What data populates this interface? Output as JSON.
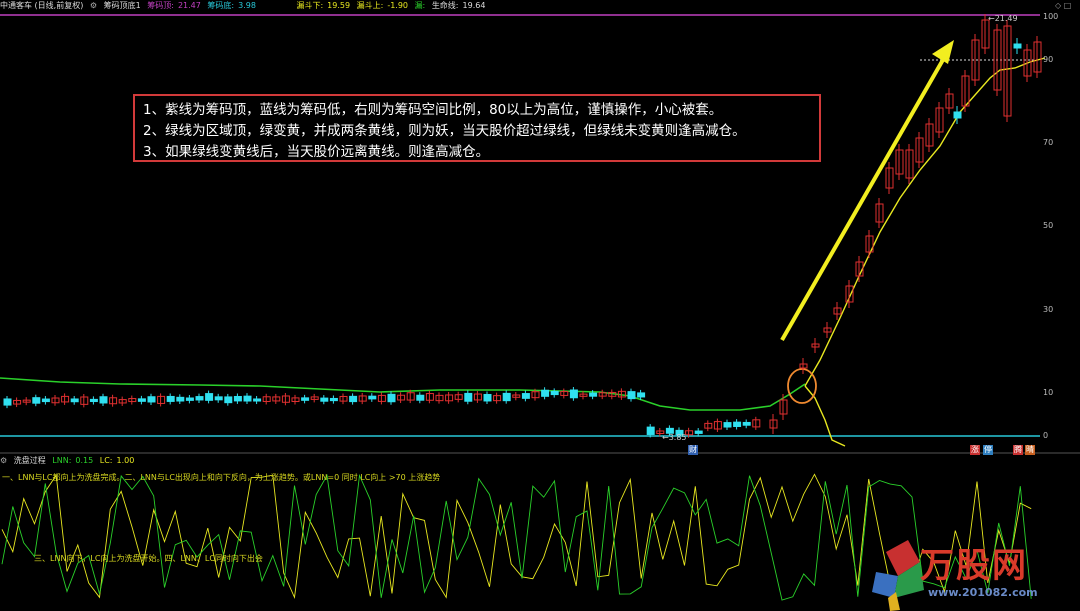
{
  "header": {
    "stock_title": "中通客车 (日线,前复权)",
    "indicator_name": "筹码顶底1",
    "chip_top_label": "筹码顶:",
    "chip_top_value": "21.47",
    "chip_bottom_label": "筹码底:",
    "chip_bottom_value": "3.98",
    "funnel_down_label": "漏斗下:",
    "funnel_down_value": "19.59",
    "funnel_up_label": "漏斗上:",
    "funnel_up_value": "-1.90",
    "stop_label": "漏:",
    "stop_value": "",
    "life_label": "生命线:",
    "life_value": "19.64"
  },
  "annotation": {
    "line1": "1、紫线为筹码顶，蓝线为筹码低，右则为筹码空间比例，80以上为高位，谨慎操作，小心被套。",
    "line2": "2、绿线为区域顶，绿变黄，并成两条黄线，则为妖，当天股价超过绿线，但绿线未变黄则逢高减仓。",
    "line3": "3、如果绿线变黄线后，当天股价远离黄线。则逢高减仓。"
  },
  "axis": {
    "labels": [
      "100",
      "90",
      "70",
      "50",
      "30",
      "10",
      "0"
    ]
  },
  "price_marks": {
    "high": "21.49",
    "low": "3.85"
  },
  "bottom_tags": {
    "cai": "财",
    "tag1": "涨",
    "tag2": "停",
    "tag3": "腾",
    "tag4": "晴"
  },
  "indicator": {
    "name": "洗盘过程",
    "lnn_label": "LNN:",
    "lnn_value": "0.15",
    "lc_label": "LC:",
    "lc_value": "1.00",
    "desc1": "一、LNN与LC都向上为洗盘完成。二、LNN与LC出现向上和向下反向，为上涨趋势。或LNN=0 同时 LC向上 >70 上涨趋势",
    "desc2": "三、LNN向下，LC向上为洗盘开始。四、LNN、LC同时向下出会"
  },
  "watermark": {
    "title": "万股网",
    "url": "www.201082.com"
  },
  "colors": {
    "chip_top": "#c040c0",
    "chip_bottom": "#28c8d8",
    "region_top": "#2ad02a",
    "yellow": "#e8e820",
    "up": "#e03030",
    "down": "#30e0f0"
  }
}
